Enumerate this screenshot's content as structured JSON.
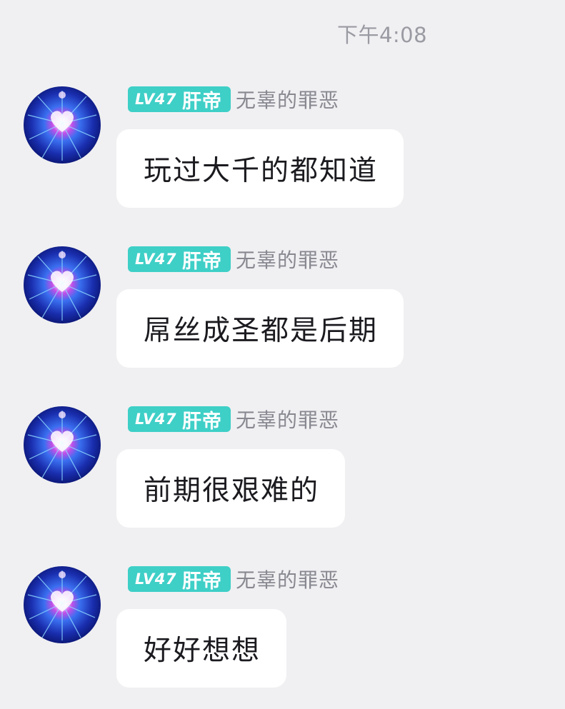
{
  "timestamp": "下午4:08",
  "messages": [
    {
      "sender": {
        "level": "LV47",
        "title": "肝帝",
        "name": "无辜的罪恶"
      },
      "text": "玩过大千的都知道"
    },
    {
      "sender": {
        "level": "LV47",
        "title": "肝帝",
        "name": "无辜的罪恶"
      },
      "text": "屌丝成圣都是后期"
    },
    {
      "sender": {
        "level": "LV47",
        "title": "肝帝",
        "name": "无辜的罪恶"
      },
      "text": "前期很艰难的"
    },
    {
      "sender": {
        "level": "LV47",
        "title": "肝帝",
        "name": "无辜的罪恶"
      },
      "text": "好好想想"
    }
  ],
  "colors": {
    "background": "#f0f0f2",
    "badge": "#3ecfc7",
    "bubble": "#ffffff",
    "timestamp": "#9a9aa3",
    "username": "#888891"
  },
  "icons": {
    "avatar": "neon-heart-avatar"
  }
}
